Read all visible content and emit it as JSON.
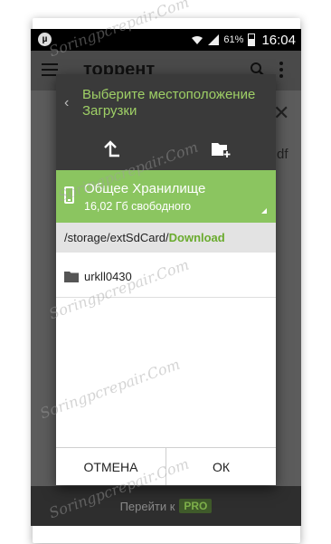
{
  "status_bar": {
    "battery": "61%",
    "time": "16:04"
  },
  "app": {
    "title": "торрент",
    "partial_text": "df",
    "close_glyph": "✕",
    "go_to_label": "Перейти к",
    "pro_label": "PRO"
  },
  "dialog": {
    "back_glyph": "‹",
    "title": "Выберите местоположение Загрузки",
    "storage": {
      "name": "Общее Хранилище",
      "free": "16,02 Гб свободного"
    },
    "path": {
      "prefix": "/storage/extSdCard/",
      "current": "Download"
    },
    "folders": [
      {
        "name": "urkll0430"
      }
    ],
    "buttons": {
      "cancel": "ОТМЕНА",
      "ok": "ОК"
    }
  },
  "colors": {
    "accent_green": "#8bc560",
    "title_green": "#9fd066",
    "dialog_dark": "#3a3a3a",
    "path_highlight": "#6aab2e"
  },
  "watermark": "Soringpcrepair.Com"
}
